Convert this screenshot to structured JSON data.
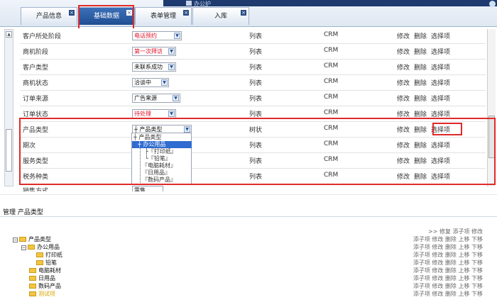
{
  "header": {
    "app_title": "办公护",
    "tabs": [
      {
        "label": "产品信息",
        "active": false
      },
      {
        "label": "基础数据",
        "active": true
      },
      {
        "label": "表单管理",
        "active": false
      },
      {
        "label": "入库",
        "active": false
      }
    ],
    "close_glyph": "×"
  },
  "scroll": {
    "up": "▲"
  },
  "grid": {
    "dd_arrow": "▼",
    "rows": [
      {
        "name": "客户所处阶段",
        "select": "电话预约",
        "red": true,
        "type": "列表",
        "crm": "CRM",
        "edit": "修改",
        "del": "删除",
        "option": "选择项"
      },
      {
        "name": "商机阶段",
        "select": "第一次拜访",
        "red": true,
        "type": "列表",
        "crm": "CRM",
        "edit": "修改",
        "del": "删除",
        "option": "选择项"
      },
      {
        "name": "客户类型",
        "select": "未联系成功",
        "red": false,
        "type": "列表",
        "crm": "CRM",
        "edit": "修改",
        "del": "删除",
        "option": "选择项"
      },
      {
        "name": "商机状态",
        "select": "洽谈中",
        "red": false,
        "type": "列表",
        "crm": "CRM",
        "edit": "修改",
        "del": "删除",
        "option": "选择项"
      },
      {
        "name": "订单来源",
        "select": "广告来源",
        "red": false,
        "type": "列表",
        "crm": "CRM",
        "edit": "修改",
        "del": "删除",
        "option": "选择项"
      },
      {
        "name": "订单状态",
        "select": "待处理",
        "red": true,
        "type": "列表",
        "crm": "CRM",
        "edit": "修改",
        "del": "删除",
        "option": "选择项"
      },
      {
        "name": "产品类型",
        "select": "┼ 产品类型",
        "red": false,
        "type": "树状",
        "crm": "CRM",
        "edit": "修改",
        "del": "删除",
        "option": "选择项"
      },
      {
        "name": "期次",
        "select": "",
        "red": false,
        "type": "列表",
        "crm": "CRM",
        "edit": "修改",
        "del": "删除",
        "option": "选择项"
      },
      {
        "name": "服务类型",
        "select": "",
        "red": false,
        "type": "列表",
        "crm": "CRM",
        "edit": "修改",
        "del": "删除",
        "option": "选择项"
      },
      {
        "name": "税务种类",
        "select": "",
        "red": false,
        "type": "列表",
        "crm": "CRM",
        "edit": "修改",
        "del": "删除",
        "option": "选择项"
      },
      {
        "name": "销售方式",
        "select": "零售",
        "red": false,
        "type": "",
        "crm": "",
        "edit": "",
        "del": "",
        "option": ""
      }
    ]
  },
  "tree_popup": {
    "items": [
      "┼ 产品类型",
      "┼ 办公用品",
      "├『打印纸』",
      "└『铅笔』",
      "『电脑耗材』",
      "『日用品』",
      "『数码产品』"
    ]
  },
  "manage": {
    "title": "管理 产品类型",
    "tree": [
      {
        "label": "产品类型",
        "toggle": "−"
      },
      {
        "label": "办公用品",
        "toggle": "−"
      },
      {
        "label": "打印纸",
        "toggle": ""
      },
      {
        "label": "铅笔",
        "toggle": ""
      },
      {
        "label": "电脑耗材",
        "toggle": ""
      },
      {
        "label": "日用品",
        "toggle": ""
      },
      {
        "label": "数码产品",
        "toggle": ""
      },
      {
        "label": "测试项",
        "toggle": ""
      }
    ],
    "ops": [
      ">> 修复 添子项 修改",
      "添子项 修改 删除 上移 下移",
      "添子项 修改 删除 上移 下移",
      "添子项 修改 删除 上移 下移",
      "添子项 修改 删除 上移 下移",
      "添子项 修改 删除 上移 下移",
      "添子项 修改 删除 上移 下移",
      "添子项 修改 删除 上移 下移",
      "添子项 修改 删除 上移 下移"
    ]
  },
  "colors": {
    "accent": "#1f4f93",
    "highlight": "#e02a2a",
    "folder": "#f4c542"
  }
}
